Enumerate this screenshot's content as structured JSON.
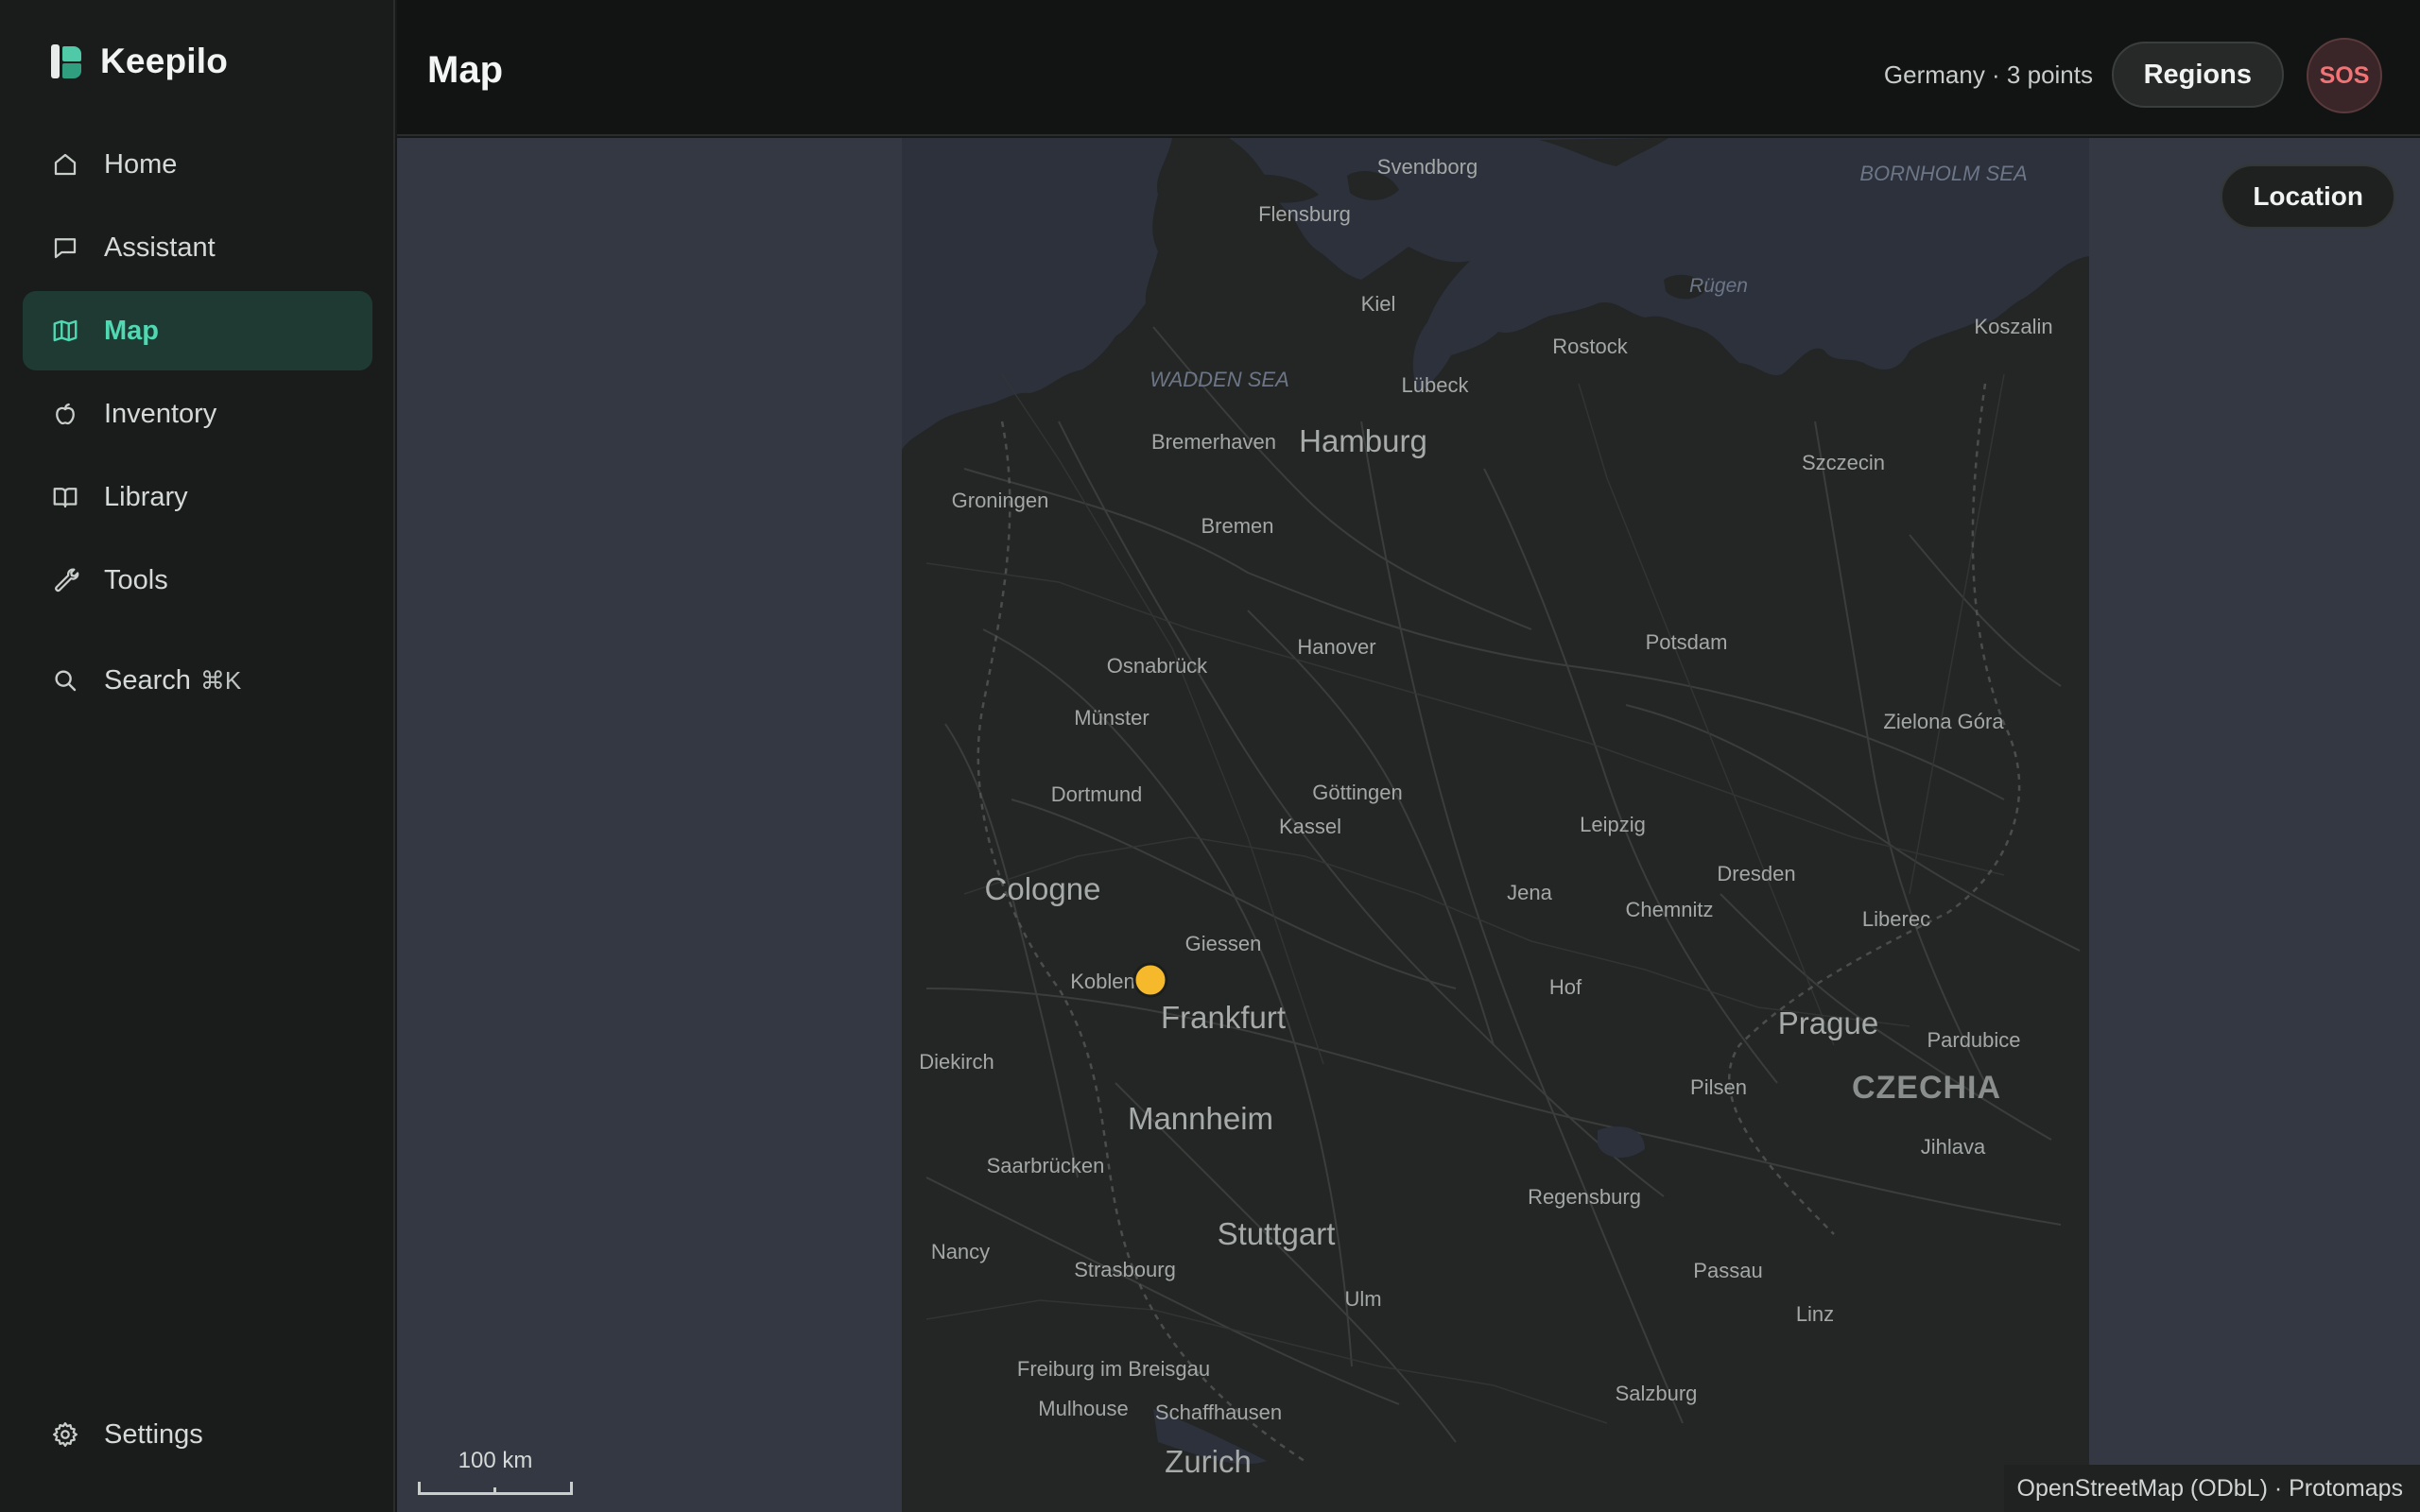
{
  "app": {
    "name": "Keepilo"
  },
  "sidebar": {
    "items": [
      {
        "label": "Home",
        "icon": "home-icon",
        "active": false
      },
      {
        "label": "Assistant",
        "icon": "chat-icon",
        "active": false
      },
      {
        "label": "Map",
        "icon": "map-icon",
        "active": true
      },
      {
        "label": "Inventory",
        "icon": "apple-icon",
        "active": false
      },
      {
        "label": "Library",
        "icon": "book-icon",
        "active": false
      },
      {
        "label": "Tools",
        "icon": "wrench-icon",
        "active": false
      }
    ],
    "search": {
      "label": "Search",
      "shortcut": "⌘K",
      "icon": "search-icon"
    },
    "settings": {
      "label": "Settings",
      "icon": "gear-icon"
    }
  },
  "header": {
    "title": "Map",
    "region_info": "Germany · 3 points",
    "regions_button": "Regions",
    "sos_button": "SOS"
  },
  "map": {
    "location_button": "Location",
    "scale_label": "100 km",
    "attribution": "OpenStreetMap (ODbL) · Protomaps",
    "marker_color": "#f5b92b",
    "labels": {
      "svendborg": "Svendborg",
      "flensburg": "Flensburg",
      "bornholm_sea": "BORNHOLM SEA",
      "rugen": "Rügen",
      "kiel": "Kiel",
      "koszalin": "Koszalin",
      "rostock": "Rostock",
      "wadden_sea": "WADDEN SEA",
      "lubeck": "Lübeck",
      "bremerhaven": "Bremerhaven",
      "hamburg": "Hamburg",
      "szczecin": "Szczecin",
      "groningen": "Groningen",
      "bremen": "Bremen",
      "hanover": "Hanover",
      "potsdam": "Potsdam",
      "osnabruck": "Osnabrück",
      "munster": "Münster",
      "zielona_gora": "Zielona Góra",
      "dortmund": "Dortmund",
      "gottingen": "Göttingen",
      "kassel": "Kassel",
      "leipzig": "Leipzig",
      "dresden": "Dresden",
      "cologne": "Cologne",
      "jena": "Jena",
      "chemnitz": "Chemnitz",
      "giessen": "Giessen",
      "liberec": "Liberec",
      "koblenz": "Koblenz",
      "hof": "Hof",
      "frankfurt": "Frankfurt",
      "prague": "Prague",
      "pardubice": "Pardubice",
      "diekirch": "Diekirch",
      "pilsen": "Pilsen",
      "czechia": "CZECHIA",
      "mannheim": "Mannheim",
      "jihlava": "Jihlava",
      "saarbrucken": "Saarbrücken",
      "regensburg": "Regensburg",
      "stuttgart": "Stuttgart",
      "nancy": "Nancy",
      "strasbourg": "Strasbourg",
      "passau": "Passau",
      "ulm": "Ulm",
      "linz": "Linz",
      "freiburg": "Freiburg im Breisgau",
      "salzburg": "Salzburg",
      "mulhouse": "Mulhouse",
      "schaffhausen": "Schaffhausen",
      "zurich": "Zurich"
    }
  }
}
